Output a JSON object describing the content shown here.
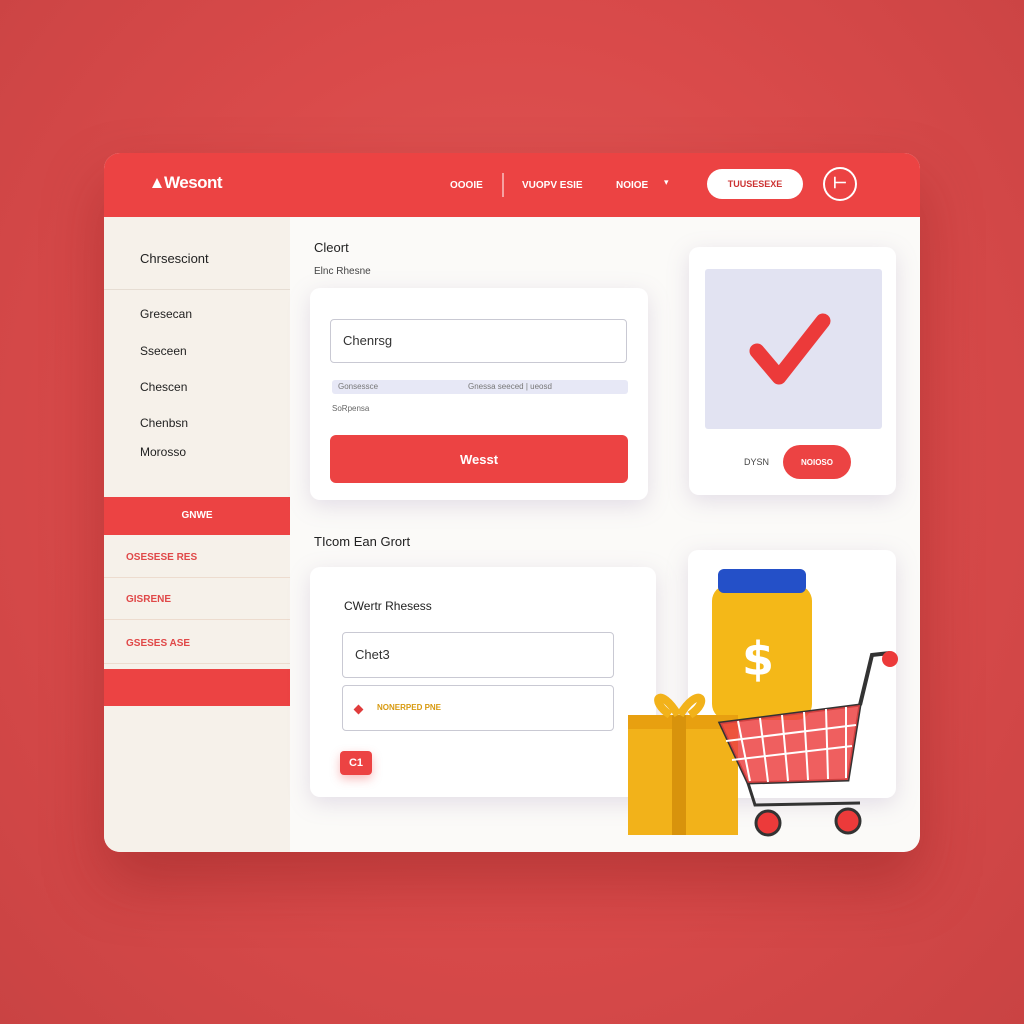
{
  "header": {
    "logo": "Wesont",
    "nav": [
      "OOOIE",
      "VUOPV ESIE",
      "NOIOE"
    ],
    "button_label": "TUUSESEXE",
    "icon_glyph": "⊢"
  },
  "sidebar": {
    "title": "Chrsesciont",
    "items": [
      "Gresecan",
      "Sseceen",
      "Chescen",
      "Chenbsn",
      "Morosso"
    ],
    "active_label": "GNWE",
    "red_items": [
      "OSESESE RES",
      "GISRENE",
      "GSESES ASE"
    ]
  },
  "form_section": {
    "title": "Cleort",
    "subtitle": "Elnc Rhesne",
    "input_value": "Chenrsg",
    "meta_left": "Gonsessce",
    "meta_right": "Gnessa seeced | ueosd",
    "tiny_text": "SoRpensa",
    "submit_label": "Wesst"
  },
  "confirm_card": {
    "label": "DYSN",
    "button_label": "NOIOSO"
  },
  "cart_section": {
    "title": "TIcom Ean Grort",
    "card_title": "CWertr Rhesess",
    "input_value": "Chet3",
    "promo_text": "NONERPED PNE",
    "badge_text": "C1"
  },
  "colors": {
    "accent": "#ec4343",
    "background": "#d94a4a",
    "panel": "#fbfaf8",
    "sidebar": "#f6f1ea",
    "check": "#ec3a3a",
    "bottle": "#f4b818",
    "cap": "#2450c8"
  },
  "icons": {
    "header_icon": "exit-icon",
    "confirm_icon": "checkmark-icon",
    "illustration": "shopping-cart-illustration"
  }
}
